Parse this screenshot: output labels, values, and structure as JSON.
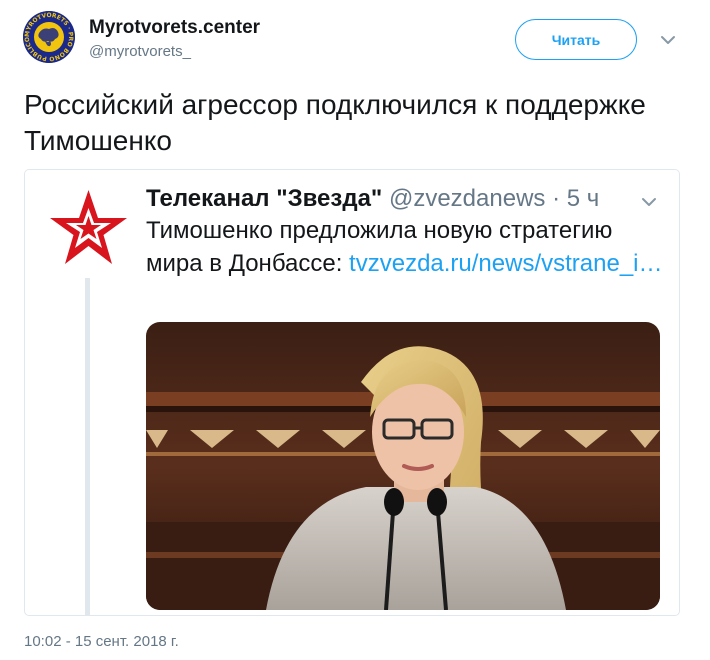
{
  "author": {
    "name": "Myrotvorets.center",
    "handle": "@myrotvorets_",
    "avatar_icon": "myrotvorets-logo-icon",
    "avatar_ring_text": "MYROTVORETS · PRO BONO PUBLICO"
  },
  "follow_button": {
    "label": "Читать"
  },
  "tweet": {
    "text": "Российский агрессор подключился к поддержке Тимошенко",
    "timestamp": "10:02 - 15 сент. 2018 г."
  },
  "quoted": {
    "name": "Телеканал \"Звезда\"",
    "handle": "@zvezdanews",
    "separator": " · ",
    "time": "5 ч",
    "text_before_link": "Тимошенко предложила новую стратегию мира в Донбассе: ",
    "link": "tvzvezda.ru/news/vstrane_i…",
    "avatar_icon": "red-star-icon",
    "media_icon": "speaker-at-microphones-photo"
  },
  "colors": {
    "accent": "#1da1f2",
    "text": "#14171a",
    "muted": "#657786",
    "border": "#e1e8ed",
    "star_red": "#d8141c"
  }
}
